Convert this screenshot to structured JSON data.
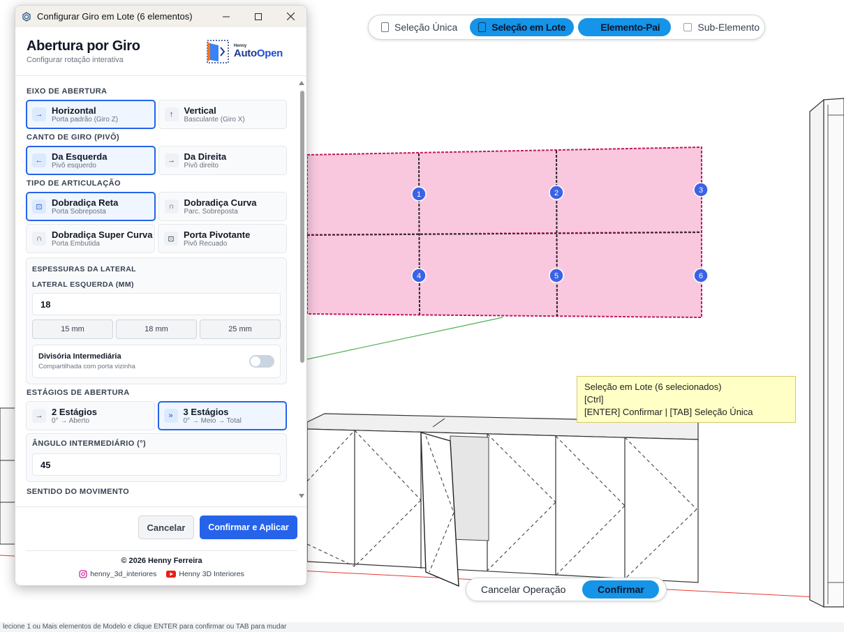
{
  "window": {
    "title": "Configurar Giro em Lote (6 elementos)"
  },
  "header": {
    "title": "Abertura por Giro",
    "subtitle": "Configurar rotação interativa",
    "logo_small": "Henny",
    "logo_auto": "Auto",
    "logo_open": "Open"
  },
  "eixo": {
    "label": "EIXO DE ABERTURA",
    "options": [
      {
        "title": "Horizontal",
        "desc": "Porta padrão (Giro Z)",
        "icon": "→"
      },
      {
        "title": "Vertical",
        "desc": "Basculante (Giro X)",
        "icon": "↑"
      }
    ]
  },
  "canto": {
    "label": "CANTO DE GIRO (PIVÔ)",
    "options": [
      {
        "title": "Da Esquerda",
        "desc": "Pivô esquerdo",
        "icon": "←"
      },
      {
        "title": "Da Direita",
        "desc": "Pivô direito",
        "icon": "→"
      }
    ]
  },
  "articulacao": {
    "label": "TIPO DE ARTICULAÇÃO",
    "options": [
      {
        "title": "Dobradiça Reta",
        "desc": "Porta Sobreposta",
        "icon": "⊡"
      },
      {
        "title": "Dobradiça Curva",
        "desc": "Parc. Sobreposta",
        "icon": "∩"
      },
      {
        "title": "Dobradiça Super Curva",
        "desc": "Porta Embutida",
        "icon": "∩"
      },
      {
        "title": "Porta Pivotante",
        "desc": "Pivô Recuado",
        "icon": "⊡"
      }
    ]
  },
  "espessuras": {
    "label": "ESPESSURAS DA LATERAL",
    "field_label": "LATERAL ESQUERDA (MM)",
    "value": "18",
    "presets": [
      "15 mm",
      "18 mm",
      "25 mm"
    ],
    "toggle_title": "Divisória Intermediária",
    "toggle_desc": "Compartilhada com porta vizinha",
    "toggle_on": false
  },
  "estagios": {
    "label": "ESTÁGIOS DE ABERTURA",
    "options": [
      {
        "title": "2 Estágios",
        "desc": "0° → Aberto",
        "icon": "→"
      },
      {
        "title": "3 Estágios",
        "desc": "0° → Meio → Total",
        "icon": "»"
      }
    ]
  },
  "angulo": {
    "label": "ÂNGULO INTERMEDIÁRIO (°)",
    "value": "45"
  },
  "sentido": {
    "label": "SENTIDO DO MOVIMENTO"
  },
  "footer": {
    "cancel": "Cancelar",
    "confirm": "Confirmar e Aplicar",
    "copyright": "© 2026 Henny Ferreira",
    "instagram": "henny_3d_interiores",
    "youtube": "Henny 3D Interiores"
  },
  "modebar": {
    "items": [
      "Seleção Única",
      "Seleção em Lote",
      "Elemento-Pai",
      "Sub-Elemento"
    ]
  },
  "tooltip": {
    "line1": "Seleção em Lote (6 selecionados)",
    "line2": "[Ctrl]",
    "line3": "[ENTER] Confirmar | [TAB] Seleção Única"
  },
  "opbar": {
    "cancel": "Cancelar Operação",
    "confirm": "Confirmar"
  },
  "door_numbers": [
    "1",
    "2",
    "3",
    "4",
    "5",
    "6"
  ],
  "status_bar": {
    "text": "lecione 1 ou Mais elementos de Modelo e clique ENTER para confirmar ou TAB para mudar"
  },
  "colors": {
    "accent": "#2563eb",
    "toolbar_accent": "#1594e8",
    "selection_fill": "#f9c8df",
    "selection_edge": "#c2185b",
    "badge": "#3b63e6"
  }
}
